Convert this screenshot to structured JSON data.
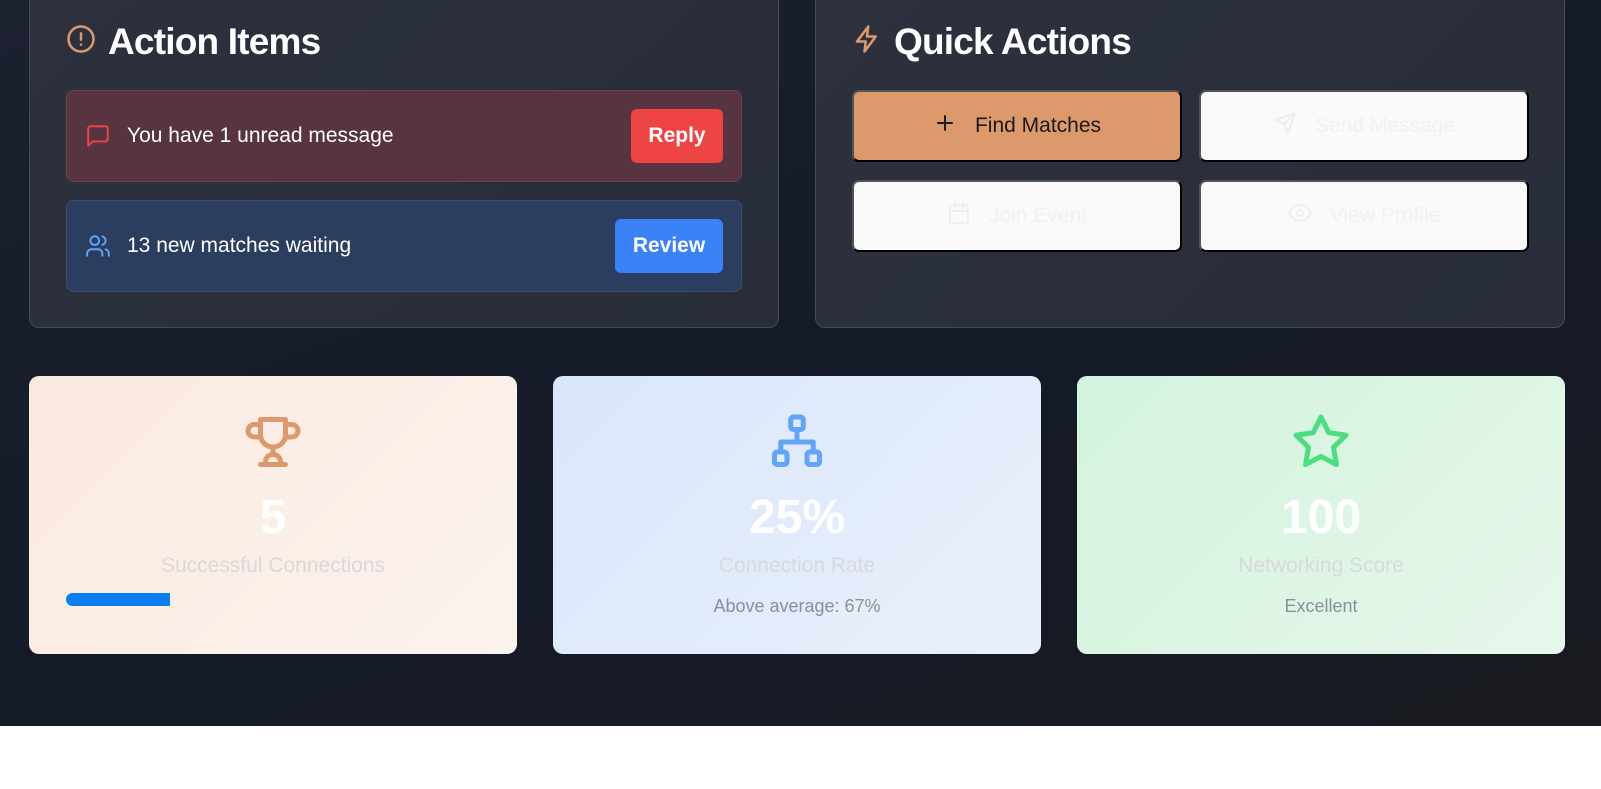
{
  "action_items": {
    "title": "Action Items",
    "alerts": [
      {
        "text": "You have 1 unread message",
        "button": "Reply",
        "icon": "message-icon"
      },
      {
        "text": "13 new matches waiting",
        "button": "Review",
        "icon": "users-icon"
      }
    ]
  },
  "quick_actions": {
    "title": "Quick Actions",
    "buttons": [
      {
        "label": "Find Matches",
        "icon": "plus-icon"
      },
      {
        "label": "Send Message",
        "icon": "send-icon"
      },
      {
        "label": "Join Event",
        "icon": "calendar-icon"
      },
      {
        "label": "View Profile",
        "icon": "eye-icon"
      }
    ]
  },
  "stats": [
    {
      "value": "5",
      "label": "Successful Connections",
      "icon": "trophy-icon",
      "progress": 0.25
    },
    {
      "value": "25%",
      "label": "Connection Rate",
      "sub": "Above average: 67%",
      "icon": "network-icon"
    },
    {
      "value": "100",
      "label": "Networking Score",
      "sub": "Excellent",
      "icon": "star-icon"
    }
  ],
  "colors": {
    "accent": "#dc9a6c",
    "danger": "#ef4444",
    "primary": "#3b82f6",
    "success": "#4ade80",
    "progress": "#0b7ff0"
  }
}
